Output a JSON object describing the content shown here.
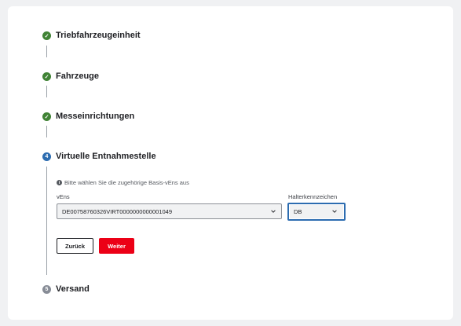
{
  "steps": [
    {
      "label": "Triebfahrzeugeinheit",
      "status": "done",
      "marker": "✓"
    },
    {
      "label": "Fahrzeuge",
      "status": "done",
      "marker": "✓"
    },
    {
      "label": "Messeinrichtungen",
      "status": "done",
      "marker": "✓"
    },
    {
      "label": "Virtuelle Entnahmestelle",
      "status": "active",
      "marker": "4"
    },
    {
      "label": "Versand",
      "status": "pending",
      "marker": "5"
    }
  ],
  "form": {
    "hint_icon": "info-icon",
    "hint_text": "Bitte wählen Sie die zugehörige Basis-vEns aus",
    "vens_label": "vEns",
    "vens_value": "DE00758760326VIRT0000000000001049",
    "halter_label": "Halterkennzeichen",
    "halter_value": "DB"
  },
  "buttons": {
    "back": "Zurück",
    "next": "Weiter"
  },
  "colors": {
    "done": "#408335",
    "active": "#2c6cb0",
    "pending": "#878c96",
    "primary": "#ec0016"
  }
}
